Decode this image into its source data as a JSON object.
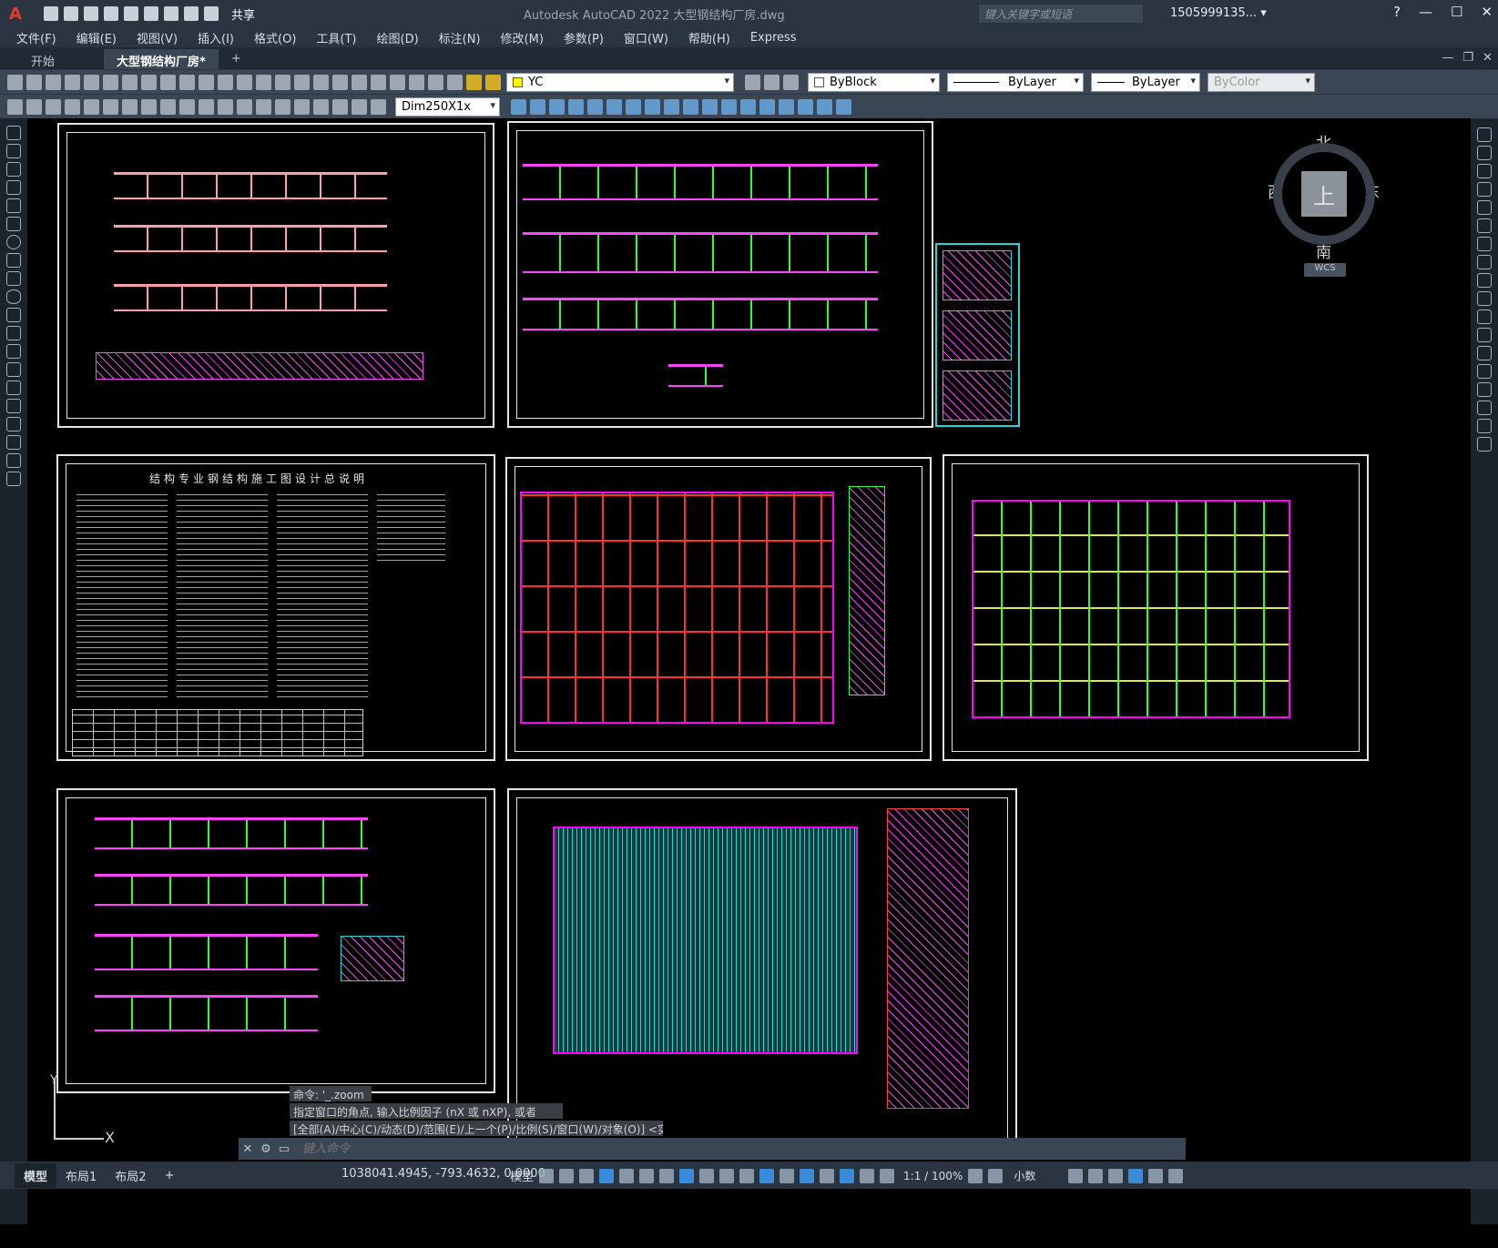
{
  "app": {
    "title": "Autodesk AutoCAD 2022    大型钢结构厂房.dwg",
    "share_label": "共享",
    "search_placeholder": "键入关键字或短语",
    "user": "1505999135... ▾",
    "accent": "#e03a2f"
  },
  "menu": [
    "文件(F)",
    "编辑(E)",
    "视图(V)",
    "插入(I)",
    "格式(O)",
    "工具(T)",
    "绘图(D)",
    "标注(N)",
    "修改(M)",
    "参数(P)",
    "窗口(W)",
    "帮助(H)",
    "Express"
  ],
  "tabs": {
    "start": "开始",
    "active": "大型钢结构厂房*",
    "plus": "+"
  },
  "toolbar": {
    "layer": "YC",
    "color": "ByBlock",
    "linetype": "ByLayer",
    "lineweight": "ByLayer",
    "plotstyle": "ByColor",
    "dimstyle": "Dim250X1x"
  },
  "viewcube": {
    "north": "北",
    "south": "南",
    "east": "东",
    "west": "西",
    "top": "上",
    "wcs": "WCS"
  },
  "drawing": {
    "doc_title": "结构专业钢结构施工图设计总说明"
  },
  "ucs": {
    "x": "X",
    "y": "Y"
  },
  "command": {
    "history": [
      "命令: '_.zoom",
      "指定窗口的角点, 输入比例因子 (nX 或 nXP), 或者",
      "[全部(A)/中心(C)/动态(D)/范围(E)/上一个(P)/比例(S)/窗口(W)/对象(O)] <实时>: _e"
    ],
    "placeholder": "键入命令"
  },
  "status": {
    "layouts": [
      "模型",
      "布局1",
      "布局2",
      "+"
    ],
    "coords": "1038041.4945, -793.4632, 0.0000",
    "model": "模型",
    "scale": "1:1 / 100%",
    "units": "小数"
  }
}
